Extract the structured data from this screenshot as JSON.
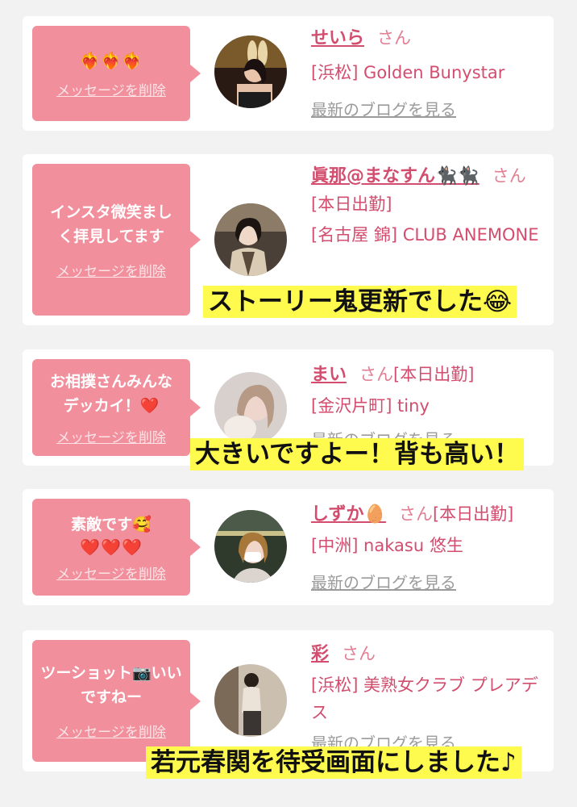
{
  "delete_label": "メッセージを削除",
  "blog_label": "最新のブログを見る",
  "honorific": "さん",
  "cards": [
    {
      "message": "❤️‍🔥❤️‍🔥❤️‍🔥",
      "name": "せいら",
      "area_shop": "[浜松] Golden Bunystar",
      "working": "",
      "caption": ""
    },
    {
      "message": "インスタ微笑ましく拝見してます",
      "name": "眞那@まなすん🐈‍⬛🐈‍⬛",
      "working": "[本日出勤]",
      "area_shop": "[名古屋 錦] CLUB ANEMONE",
      "caption": "ストーリー鬼更新でした😂"
    },
    {
      "message": "お相撲さんみんなデッカイ！❤️",
      "name": "まい",
      "working": "[本日出勤]",
      "area_shop": "[金沢片町] tiny",
      "caption": "大きいですよー！背も高い！"
    },
    {
      "message": "素敵です🥰",
      "message2": "❤️❤️❤️",
      "name": "しずか🥚",
      "working": "[本日出勤]",
      "area_shop": "[中洲] nakasu 悠生",
      "caption": ""
    },
    {
      "message": "ツーショット📷いいですねー",
      "name": "彩",
      "working": "",
      "area_shop": "[浜松] 美熟女クラブ プレアデス",
      "caption": "若元春関を待受画面にしました♪"
    }
  ],
  "colors": {
    "bubble": "#f28f9c",
    "name": "#d24d6e",
    "highlight": "#fffa4e",
    "background": "#f2f2f2"
  }
}
